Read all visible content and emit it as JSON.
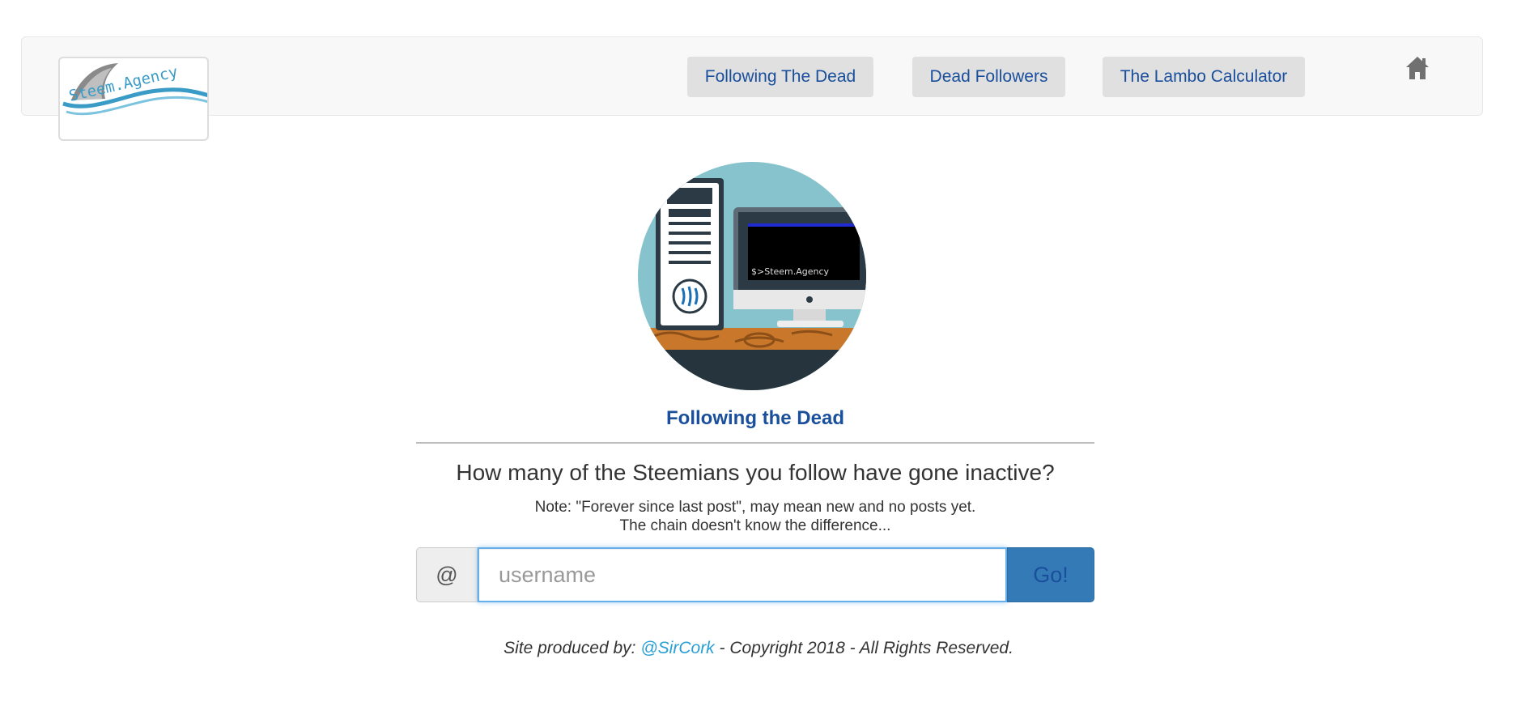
{
  "brand": {
    "logo_text": "Steem.Agency"
  },
  "nav": {
    "items": [
      {
        "label": "Following The Dead"
      },
      {
        "label": "Dead Followers"
      },
      {
        "label": "The Lambo Calculator"
      }
    ],
    "home_icon": "home-icon"
  },
  "hero": {
    "terminal_text": "$>Steem.Agency"
  },
  "main": {
    "title": "Following the Dead",
    "question": "How many of the Steemians you follow have gone inactive?",
    "note_line1": "Note: \"Forever since last post\", may mean new and no posts yet.",
    "note_line2": "The chain doesn't know the difference..."
  },
  "search": {
    "prefix": "@",
    "placeholder": "username",
    "value": "",
    "button_label": "Go!"
  },
  "footer": {
    "prefix": "Site produced by: ",
    "author": "@SirCork",
    "suffix": " - Copyright 2018 - All Rights Reserved."
  },
  "colors": {
    "brand_blue": "#1a4f9c",
    "go_button": "#337ab7",
    "link": "#2a9fd6",
    "navbar_bg": "#f8f8f8",
    "nav_button_bg": "#e0e0e0"
  }
}
